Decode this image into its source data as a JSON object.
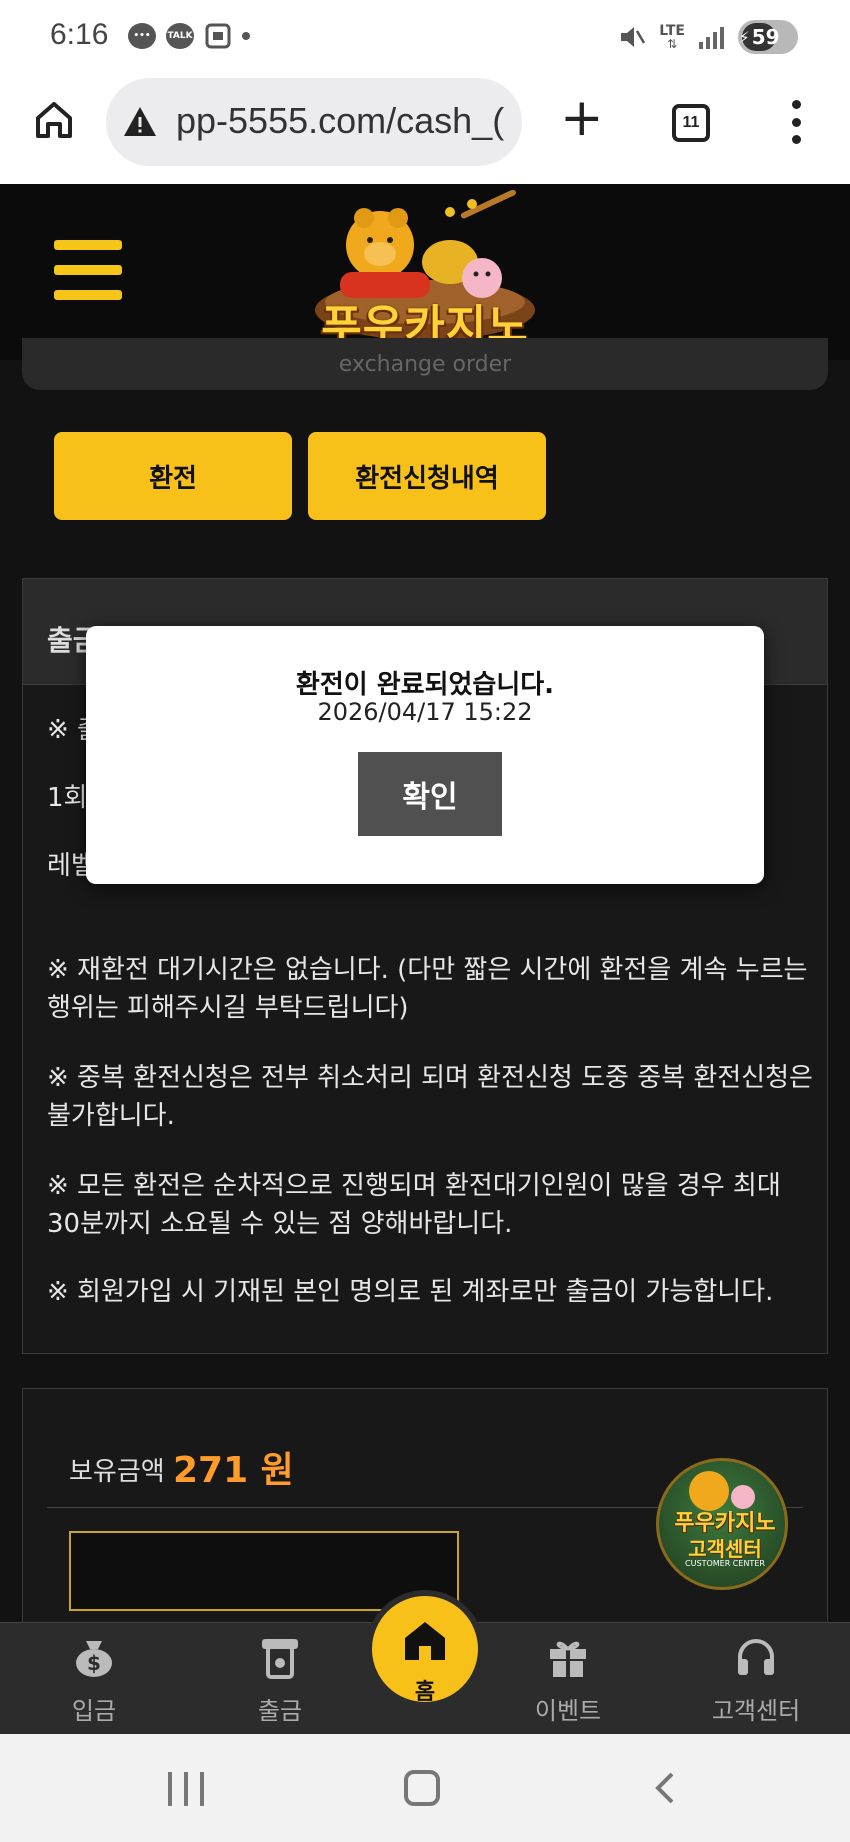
{
  "status_bar": {
    "time": "6:16",
    "talk_label": "TALK",
    "network": "LTE",
    "battery": "59"
  },
  "browser": {
    "url": "pp-5555.com/cash_(",
    "tab_count": "11"
  },
  "header": {
    "logo_text": "푸우카지노",
    "order_label": "exchange order"
  },
  "tabs": [
    {
      "label": "환전"
    },
    {
      "label": "환전신청내역"
    }
  ],
  "notice": {
    "title": "출금신청전 반드시 확인해 주세요",
    "lines": [
      "※ 출",
      "1회",
      "레벨",
      "※ 재환전 대기시간은 없습니다. (다만 짧은 시간에 환전을 계속 누르는 행위는 피해주시길 부탁드립니다)",
      "※ 중복 환전신청은 전부 취소처리 되며 환전신청 도중 중복 환전신청은 불가합니다.",
      "※ 모든 환전은 순차적으로 진행되며 환전대기인원이 많을 경우 최대 30분까지 소요될 수 있는 점 양해바랍니다.",
      "※ 회원가입 시 기재된 본인 명의로 된 계좌로만 출금이 가능합니다."
    ]
  },
  "balance": {
    "label": "보유금액",
    "amount": "271 원"
  },
  "customer_center_badge": {
    "title": "푸우카지노",
    "subtitle": "고객센터",
    "english": "CUSTOMER CENTER"
  },
  "bottom_nav": {
    "deposit": "입금",
    "withdraw": "출금",
    "home": "홈",
    "event": "이벤트",
    "support": "고객센터"
  },
  "modal": {
    "message": "환전이 완료되었습니다.",
    "timestamp": "2026/04/17 15:22",
    "ok_label": "확인"
  },
  "colors": {
    "accent": "#f8c11a",
    "amount": "#ff9c2a",
    "background": "#121212"
  }
}
